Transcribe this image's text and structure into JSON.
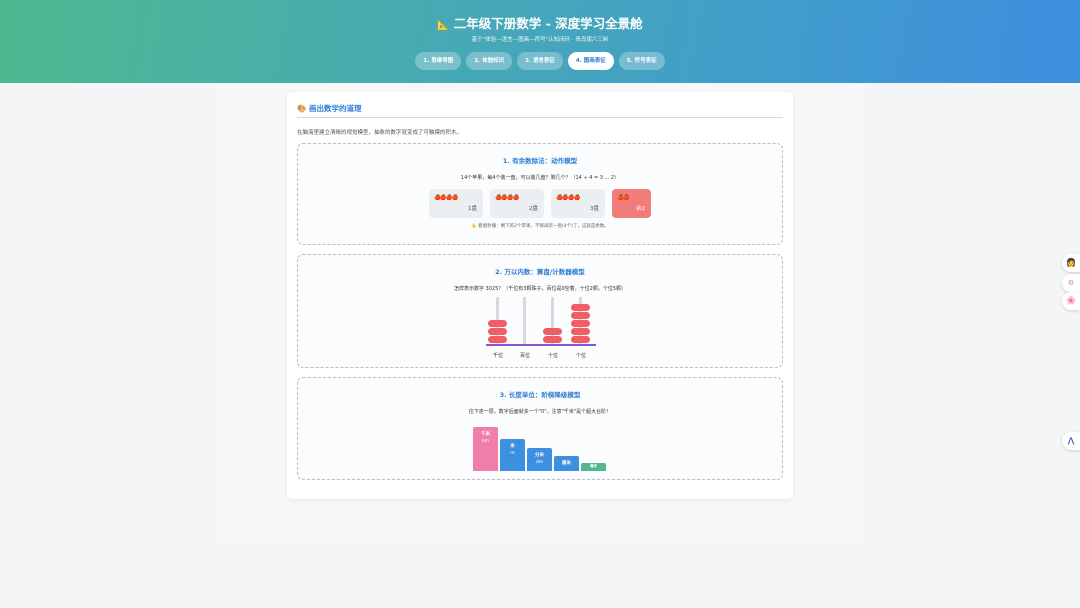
{
  "header": {
    "title_icon": "📐",
    "title": "二年级下册数学 - 深度学习全景舱",
    "subtitle": "基于\"体验—语言—图画—符号\"认知闭环 · 青岛版六三制",
    "tabs": [
      "1. 思维导图",
      "2. 体验知识",
      "3. 语言表征",
      "4. 图画表征",
      "5. 符号表征"
    ],
    "active_tab": 3
  },
  "section": {
    "icon": "🎨",
    "title": "画出数学的道理",
    "desc": "在脑海里建立清晰的视觉模型，抽象的数字就变成了可触摸的积木。"
  },
  "division": {
    "title": "1. 有余数除法：动作模型",
    "question": "14个苹果，每4个装一盘，可以装几盘？剩几个？（14 ÷ 4 = 3 ... 2）",
    "plates": [
      {
        "apples": "🍎🍎🍎🍎",
        "label": "1盘"
      },
      {
        "apples": "🍎🍎🍎🍎",
        "label": "2盘"
      },
      {
        "apples": "🍎🍎🍎🍎",
        "label": "3盘"
      },
      {
        "apples": "🍎🍎",
        "label": "余2"
      }
    ],
    "note_icon": "👆",
    "note": "看图秒懂：剩下的2个苹果，不够再装一盘(4个)了，这就是余数。"
  },
  "abacus": {
    "title": "2. 万以内数：算盘/计数器模型",
    "question": "怎样表示数字 3025？（千位有3颗珠子，百位是0空着，十位2颗，个位5颗）",
    "places": [
      {
        "label": "千位",
        "beads": 3
      },
      {
        "label": "百位",
        "beads": 0
      },
      {
        "label": "十位",
        "beads": 2
      },
      {
        "label": "个位",
        "beads": 5
      }
    ]
  },
  "length": {
    "title": "3. 长度单位：阶梯降级模型",
    "question": "往下走一层，数字后面就多一个\"0\"。注意\"千米\"是个超大台阶！",
    "units": [
      {
        "name": "千米",
        "sub": "km",
        "color": "#ef7fa8"
      },
      {
        "name": "米",
        "sub": "m",
        "color": "#3d8fe0"
      },
      {
        "name": "分米",
        "sub": "dm",
        "color": "#3d8fe0"
      },
      {
        "name": "厘米",
        "sub": "",
        "color": "#3d8fe0"
      },
      {
        "name": "毫米",
        "sub": "",
        "color": "#4fb88f"
      }
    ]
  },
  "sidebar": {
    "items": [
      {
        "icon": "👩"
      },
      {
        "icon": "⚙"
      },
      {
        "icon": "🌸"
      },
      {
        "icon": "⋀"
      }
    ]
  }
}
